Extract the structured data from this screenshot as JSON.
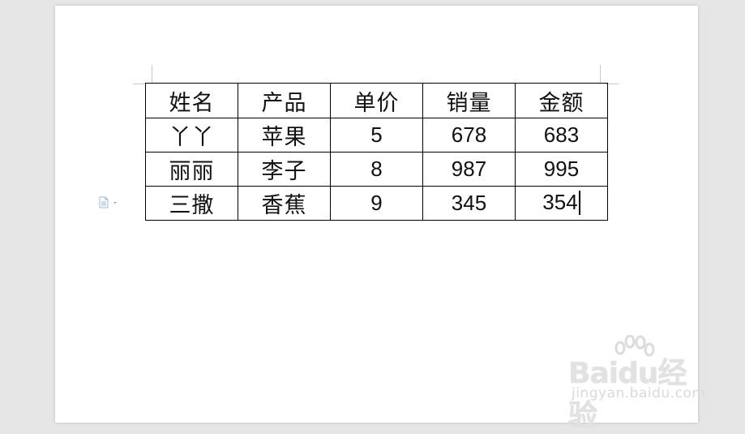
{
  "table": {
    "headers": [
      "姓名",
      "产品",
      "单价",
      "销量",
      "金额"
    ],
    "rows": [
      [
        "丫丫",
        "苹果",
        "5",
        "678",
        "683"
      ],
      [
        "丽丽",
        "李子",
        "8",
        "987",
        "995"
      ],
      [
        "三撒",
        "香蕉",
        "9",
        "345",
        "354"
      ]
    ]
  },
  "watermark": {
    "brand": "Baidu经验",
    "url": "jingyan.baidu.com"
  },
  "icons": {
    "paragraph_handle": "document-icon"
  }
}
